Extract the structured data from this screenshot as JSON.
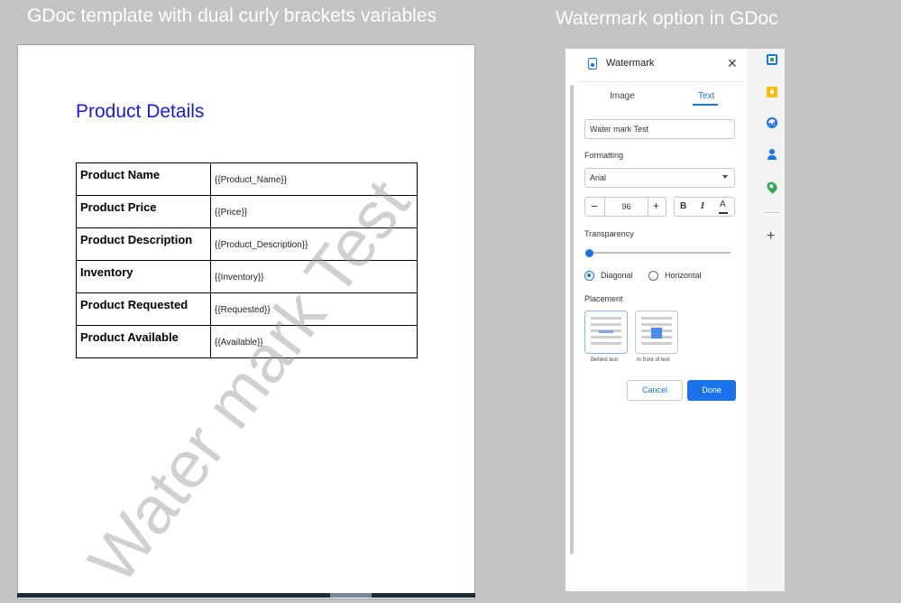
{
  "captions": {
    "left": "GDoc template with dual curly brackets variables",
    "right": "Watermark option in GDoc"
  },
  "document": {
    "title": "Product Details",
    "watermark_text": "Water mark Test",
    "rows": [
      {
        "label": "Product Name",
        "value": "{{Product_Name}}"
      },
      {
        "label": "Product Price",
        "value": "{{Price}}"
      },
      {
        "label": "Product Description",
        "value": "{{Product_Description}}"
      },
      {
        "label": "Inventory",
        "value": "{{Inventory}}"
      },
      {
        "label": "Product Requested",
        "value": "{{Requested}}"
      },
      {
        "label": "Product Available",
        "value": "{{Available}}"
      }
    ]
  },
  "panel": {
    "title": "Watermark",
    "tabs": {
      "image": "Image",
      "text": "Text"
    },
    "text_value": "Water mark Test",
    "formatting_label": "Formatting",
    "font_value": "Arial",
    "size_value": "96",
    "bold_label": "B",
    "italic_label": "I",
    "color_label": "A",
    "transparency_label": "Transparency",
    "transparency_value_percent": 0,
    "orientation": {
      "diagonal": "Diagonal",
      "horizontal": "Horizontal",
      "selected": "Diagonal"
    },
    "placement_label": "Placement",
    "placement": {
      "behind": "Behind text",
      "front": "In front of text",
      "selected": "Behind text"
    },
    "cancel_label": "Cancel",
    "done_label": "Done"
  },
  "colors": {
    "accent": "#1a73e8",
    "doc_title": "#1a1adf",
    "background": "#c3c3c3"
  },
  "side_rail_icons": [
    "calendar-icon",
    "keep-icon",
    "tasks-icon",
    "contacts-icon",
    "maps-icon",
    "add-icon"
  ]
}
